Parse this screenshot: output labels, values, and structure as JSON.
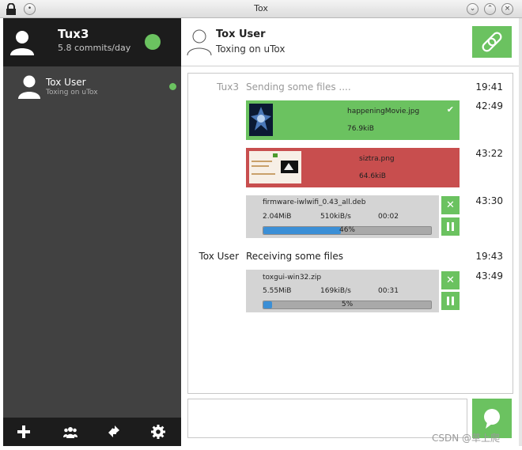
{
  "window": {
    "title": "Tox"
  },
  "self": {
    "name": "Tux3",
    "status": "5.8 commits/day",
    "status_color": "#6bc260"
  },
  "friends": [
    {
      "name": "Tox User",
      "status": "Toxing on uTox",
      "online_color": "#6bc260"
    }
  ],
  "bottom_bar": [
    "plus-icon",
    "group-icon",
    "transfer-icon",
    "gear-icon"
  ],
  "chat": {
    "contact_name": "Tox User",
    "contact_status": "Toxing on uTox",
    "messages": [
      {
        "author": "Tux3",
        "text": "Sending some files ....",
        "time": "19:41"
      },
      {
        "author": "Tox User",
        "text": "Receiving some files",
        "time": "19:43"
      }
    ],
    "transfers": [
      {
        "filename": "happeningMovie.jpg",
        "size": "76.9kiB",
        "time": "42:49",
        "state": "done",
        "color": "#6bc260"
      },
      {
        "filename": "siztra.png",
        "size": "64.6kiB",
        "time": "43:22",
        "state": "failed",
        "color": "#c84e4e"
      },
      {
        "filename": "firmware-iwlwifi_0.43_all.deb",
        "size": "2.04MiB",
        "speed": "510kiB/s",
        "eta": "00:02",
        "progress": 0.46,
        "progress_label": "46%",
        "time": "43:30",
        "state": "active"
      },
      {
        "filename": "toxgui-win32.zip",
        "size": "5.55MiB",
        "speed": "169kiB/s",
        "eta": "00:31",
        "progress": 0.05,
        "progress_label": "5%",
        "time": "43:49",
        "state": "active"
      }
    ]
  },
  "watermark": "CSDN @草上爬",
  "accent_color": "#6bc260"
}
